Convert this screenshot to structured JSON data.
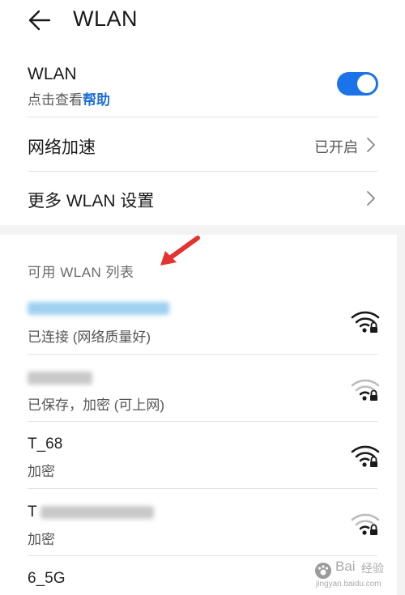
{
  "header": {
    "title": "WLAN",
    "back_icon": "arrow-left-icon"
  },
  "wlan_row": {
    "title": "WLAN",
    "subtitle_prefix": "点击查看",
    "help_link": "帮助",
    "toggle_on": true,
    "accent_color": "#1a73e8"
  },
  "accel_row": {
    "title": "网络加速",
    "value": "已开启"
  },
  "more_row": {
    "title": "更多 WLAN 设置"
  },
  "list": {
    "section_label": "可用 WLAN 列表",
    "networks": [
      {
        "name": "",
        "status": "已连接 (网络质量好)",
        "signal": "full",
        "locked": true
      },
      {
        "name": "",
        "status": "已保存，加密 (可上网)",
        "signal": "weak",
        "locked": true
      },
      {
        "name": "T_68",
        "status": "加密",
        "signal": "full",
        "locked": true
      },
      {
        "name": "T",
        "status": "加密",
        "signal": "weak",
        "locked": true
      },
      {
        "name": "6_5G",
        "status": "",
        "signal": "full",
        "locked": true
      }
    ]
  },
  "watermark": {
    "brand": "Bai",
    "sub": "经验",
    "url": "jingyan.baidu.com"
  }
}
